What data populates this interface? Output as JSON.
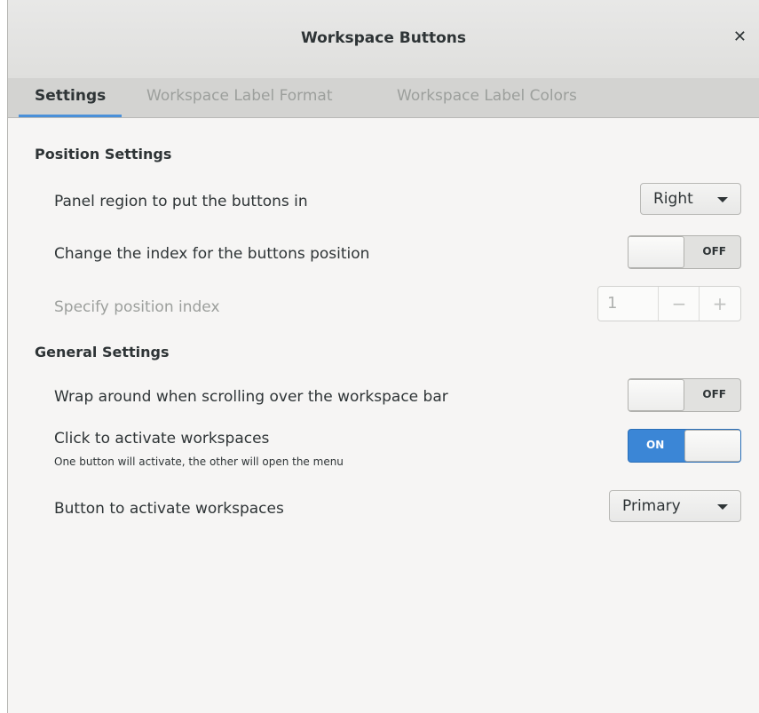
{
  "window": {
    "title": "Workspace Buttons"
  },
  "tabs": [
    {
      "label": "Settings",
      "active": true
    },
    {
      "label": "Workspace Label Format",
      "active": false
    },
    {
      "label": "Workspace Label Colors",
      "active": false
    }
  ],
  "position_settings": {
    "title": "Position Settings",
    "panel_region": {
      "label": "Panel region to put the buttons in",
      "value": "Right"
    },
    "change_index": {
      "label": "Change the index for the buttons position",
      "state": "OFF"
    },
    "position_index": {
      "label": "Specify position index",
      "value": "1",
      "minus": "−",
      "plus": "+"
    }
  },
  "general_settings": {
    "title": "General Settings",
    "wrap_around": {
      "label": "Wrap around when scrolling over the workspace bar",
      "state": "OFF"
    },
    "click_activate": {
      "label": "Click to activate workspaces",
      "sublabel": "One button will activate, the other will open the menu",
      "state": "ON"
    },
    "activate_button": {
      "label": "Button to activate workspaces",
      "value": "Primary"
    }
  },
  "colors": {
    "accent": "#4a90d9",
    "switch_on": "#3b86d6"
  },
  "icons": {
    "close": "close-icon",
    "dropdown": "chevron-down-icon"
  }
}
